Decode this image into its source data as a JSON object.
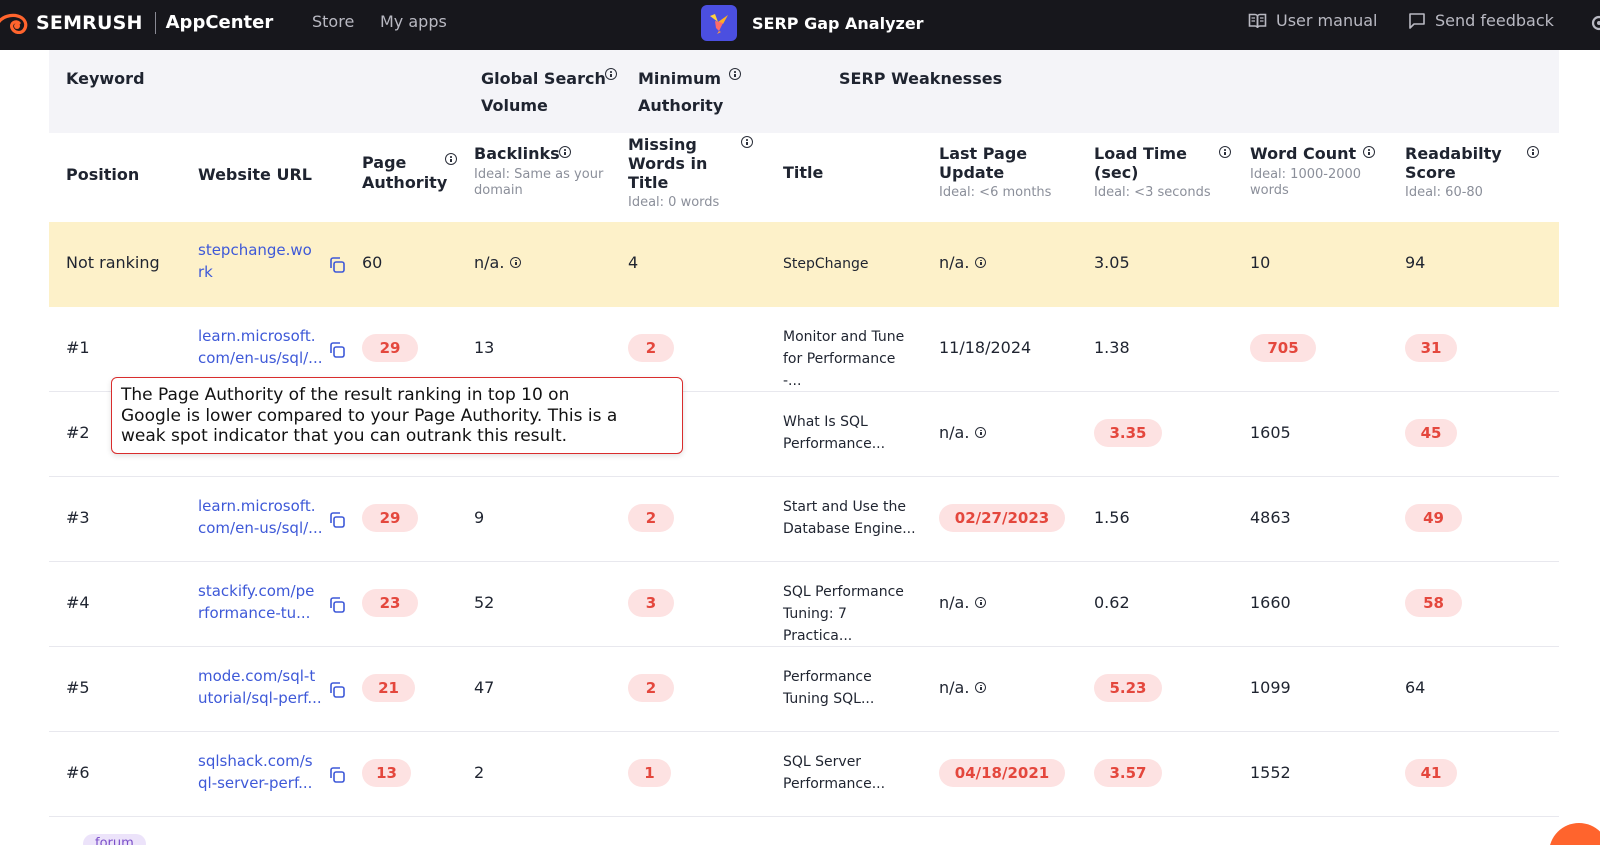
{
  "topbar": {
    "brand": "SEMRUSH",
    "app_center": "AppCenter",
    "nav": [
      "Store",
      "My apps"
    ],
    "app_title": "SERP Gap Analyzer",
    "user_manual": "User manual",
    "send_feedback": "Send feedback"
  },
  "keyword_header": {
    "keyword": "Keyword",
    "global_search_volume": [
      "Global Search",
      "Volume"
    ],
    "minimum_authority": [
      "Minimum",
      "Authority"
    ],
    "serp_weaknesses": "SERP Weaknesses"
  },
  "columns": {
    "position": "Position",
    "website_url": "Website URL",
    "page_authority": [
      "Page",
      "Authority"
    ],
    "backlinks": "Backlinks",
    "backlinks_sub": [
      "Ideal: Same as your",
      "domain"
    ],
    "missing_words": [
      "Missing",
      "Words in",
      "Title"
    ],
    "missing_words_sub": "Ideal: 0 words",
    "title": "Title",
    "last_update": [
      "Last Page",
      "Update"
    ],
    "last_update_sub": "Ideal: <6 months",
    "load_time": [
      "Load Time",
      "(sec)"
    ],
    "load_time_sub": "Ideal: <3 seconds",
    "word_count": "Word Count",
    "word_count_sub": [
      "Ideal: 1000-2000",
      "words"
    ],
    "readability": [
      "Readabilty",
      "Score"
    ],
    "readability_sub": "Ideal: 60-80"
  },
  "rows": [
    {
      "position": "Not ranking",
      "url": [
        "stepchange.wo",
        "rk"
      ],
      "page_authority": "60",
      "backlinks": "n/a.",
      "missing_words": "4",
      "title": [
        "StepChange"
      ],
      "last_update": "n/a.",
      "load_time": "3.05",
      "word_count": "10",
      "readability": "94"
    },
    {
      "position": "#1",
      "url": [
        "learn.microsoft.",
        "com/en-us/sql/..."
      ],
      "page_authority": "29",
      "backlinks": "13",
      "missing_words": "2",
      "title": [
        "Monitor and Tune",
        "for Performance -..."
      ],
      "last_update": "11/18/2024",
      "load_time": "1.38",
      "word_count": "705",
      "readability": "31"
    },
    {
      "position": "#2",
      "url": [
        "",
        ""
      ],
      "page_authority": "",
      "backlinks": "",
      "missing_words": "",
      "title": [
        "What Is SQL",
        "Performance..."
      ],
      "last_update": "n/a.",
      "load_time": "3.35",
      "word_count": "1605",
      "readability": "45"
    },
    {
      "position": "#3",
      "url": [
        "learn.microsoft.",
        "com/en-us/sql/..."
      ],
      "page_authority": "29",
      "backlinks": "9",
      "missing_words": "2",
      "title": [
        "Start and Use the",
        "Database Engine..."
      ],
      "last_update": "02/27/2023",
      "load_time": "1.56",
      "word_count": "4863",
      "readability": "49"
    },
    {
      "position": "#4",
      "url": [
        "stackify.com/pe",
        "rformance-tu..."
      ],
      "page_authority": "23",
      "backlinks": "52",
      "missing_words": "3",
      "title": [
        "SQL Performance",
        "Tuning: 7 Practica..."
      ],
      "last_update": "n/a.",
      "load_time": "0.62",
      "word_count": "1660",
      "readability": "58"
    },
    {
      "position": "#5",
      "url": [
        "mode.com/sql-t",
        "utorial/sql-perf..."
      ],
      "page_authority": "21",
      "backlinks": "47",
      "missing_words": "2",
      "title": [
        "Performance",
        "Tuning SQL..."
      ],
      "last_update": "n/a.",
      "load_time": "5.23",
      "word_count": "1099",
      "readability": "64"
    },
    {
      "position": "#6",
      "url": [
        "sqlshack.com/s",
        "ql-server-perf..."
      ],
      "page_authority": "13",
      "backlinks": "2",
      "missing_words": "1",
      "title": [
        "SQL Server",
        "Performance..."
      ],
      "last_update": "04/18/2021",
      "load_time": "3.57",
      "word_count": "1552",
      "readability": "41"
    }
  ],
  "tooltip": [
    "The Page Authority of the result ranking in top 10 on",
    "Google is lower compared to your Page Authority. This is a",
    "weak spot indicator that you can outrank this result."
  ],
  "forum_tag": "forum",
  "colors": {
    "topbar": "#17171c",
    "brand_orange": "#ff642d",
    "app_logo": "#4b4fe0",
    "link": "#3e59d8",
    "highlight_row": "#fdf1c9",
    "weak_pill_bg": "#fde2e2",
    "weak_pill_text": "#e4473d",
    "tooltip_border": "#d92d2d"
  }
}
